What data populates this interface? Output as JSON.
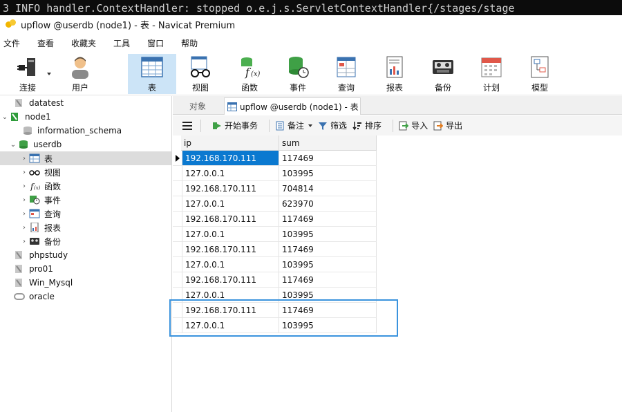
{
  "terminal": {
    "text": "3 INFO handler.ContextHandler: stopped o.e.j.s.ServletContextHandler{/stages/stage"
  },
  "window": {
    "title": "upflow @userdb (node1) - 表 - Navicat Premium"
  },
  "menu": [
    "文件",
    "查看",
    "收藏夹",
    "工具",
    "窗口",
    "帮助"
  ],
  "toolbar": {
    "connect": "连接",
    "user": "用户",
    "table": "表",
    "view": "视图",
    "function": "函数",
    "event": "事件",
    "query": "查询",
    "report": "报表",
    "backup": "备份",
    "schedule": "计划",
    "model": "模型"
  },
  "tree": {
    "datatest": "datatest",
    "node1": "node1",
    "information_schema": "information_schema",
    "userdb": "userdb",
    "tables": "表",
    "views": "视图",
    "functions": "函数",
    "events": "事件",
    "queries": "查询",
    "reports": "报表",
    "backups": "备份",
    "phpstudy": "phpstudy",
    "pro01": "pro01",
    "win_mysql": "Win_Mysql",
    "oracle": "oracle"
  },
  "tabs": {
    "objects": "对象",
    "active": "upflow @userdb (node1) - 表"
  },
  "subtoolbar": {
    "begin_transaction": "开始事务",
    "memo": "备注",
    "filter": "筛选",
    "sort": "排序",
    "import": "导入",
    "export": "导出"
  },
  "grid": {
    "columns": [
      "ip",
      "sum"
    ],
    "rows": [
      [
        "192.168.170.111",
        "117469"
      ],
      [
        "127.0.0.1",
        "103995"
      ],
      [
        "192.168.170.111",
        "704814"
      ],
      [
        "127.0.0.1",
        "623970"
      ],
      [
        "192.168.170.111",
        "117469"
      ],
      [
        "127.0.0.1",
        "103995"
      ],
      [
        "192.168.170.111",
        "117469"
      ],
      [
        "127.0.0.1",
        "103995"
      ],
      [
        "192.168.170.111",
        "117469"
      ],
      [
        "127.0.0.1",
        "103995"
      ],
      [
        "192.168.170.111",
        "117469"
      ],
      [
        "127.0.0.1",
        "103995"
      ]
    ]
  },
  "colors": {
    "selection": "#0b79d0",
    "highlight_box": "#3a93dd",
    "active_tool": "#cce4f7"
  }
}
